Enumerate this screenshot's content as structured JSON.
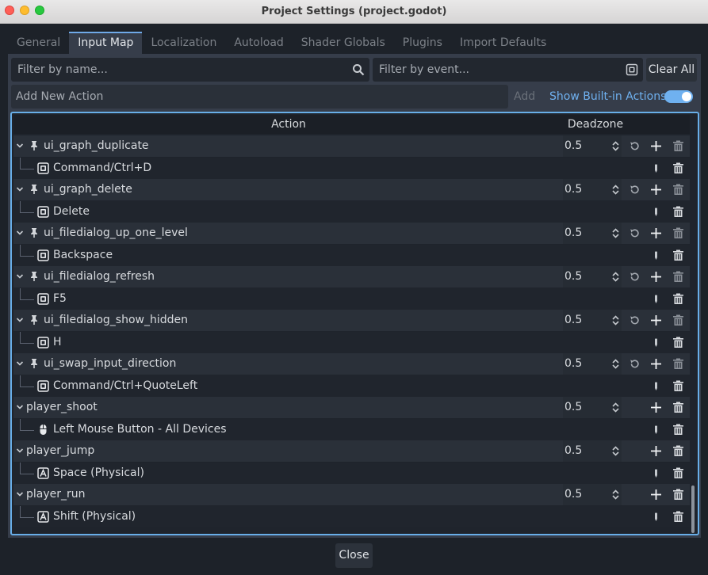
{
  "window": {
    "title": "Project Settings (project.godot)"
  },
  "tabs": [
    "General",
    "Input Map",
    "Localization",
    "Autoload",
    "Shader Globals",
    "Plugins",
    "Import Defaults"
  ],
  "active_tab": "Input Map",
  "filters": {
    "name_placeholder": "Filter by name...",
    "event_placeholder": "Filter by event...",
    "clear_all": "Clear All"
  },
  "add_action": {
    "placeholder": "Add New Action",
    "add_label": "Add",
    "show_builtin_label": "Show Built-in Actions",
    "show_builtin_on": true
  },
  "table": {
    "headers": {
      "action": "Action",
      "deadzone": "Deadzone"
    },
    "actions": [
      {
        "name": "ui_graph_duplicate",
        "builtin": true,
        "deadzone": "0.5",
        "event": "Command/Ctrl+D",
        "event_icon": "keyboard-icon"
      },
      {
        "name": "ui_graph_delete",
        "builtin": true,
        "deadzone": "0.5",
        "event": "Delete",
        "event_icon": "keyboard-icon"
      },
      {
        "name": "ui_filedialog_up_one_level",
        "builtin": true,
        "deadzone": "0.5",
        "event": "Backspace",
        "event_icon": "keyboard-icon"
      },
      {
        "name": "ui_filedialog_refresh",
        "builtin": true,
        "deadzone": "0.5",
        "event": "F5",
        "event_icon": "keyboard-icon"
      },
      {
        "name": "ui_filedialog_show_hidden",
        "builtin": true,
        "deadzone": "0.5",
        "event": "H",
        "event_icon": "keyboard-icon"
      },
      {
        "name": "ui_swap_input_direction",
        "builtin": true,
        "deadzone": "0.5",
        "event": "Command/Ctrl+QuoteLeft",
        "event_icon": "keyboard-icon"
      },
      {
        "name": "player_shoot",
        "builtin": false,
        "deadzone": "0.5",
        "event": "Left Mouse Button - All Devices",
        "event_icon": "mouse-icon"
      },
      {
        "name": "player_jump",
        "builtin": false,
        "deadzone": "0.5",
        "event": "Space (Physical)",
        "event_icon": "keyboard-physical-icon"
      },
      {
        "name": "player_run",
        "builtin": false,
        "deadzone": "0.5",
        "event": "Shift (Physical)",
        "event_icon": "keyboard-physical-icon"
      }
    ]
  },
  "footer": {
    "close_label": "Close"
  },
  "colors": {
    "accent": "#6fb1f0",
    "panel": "#363d4a",
    "background": "#1d2229"
  }
}
